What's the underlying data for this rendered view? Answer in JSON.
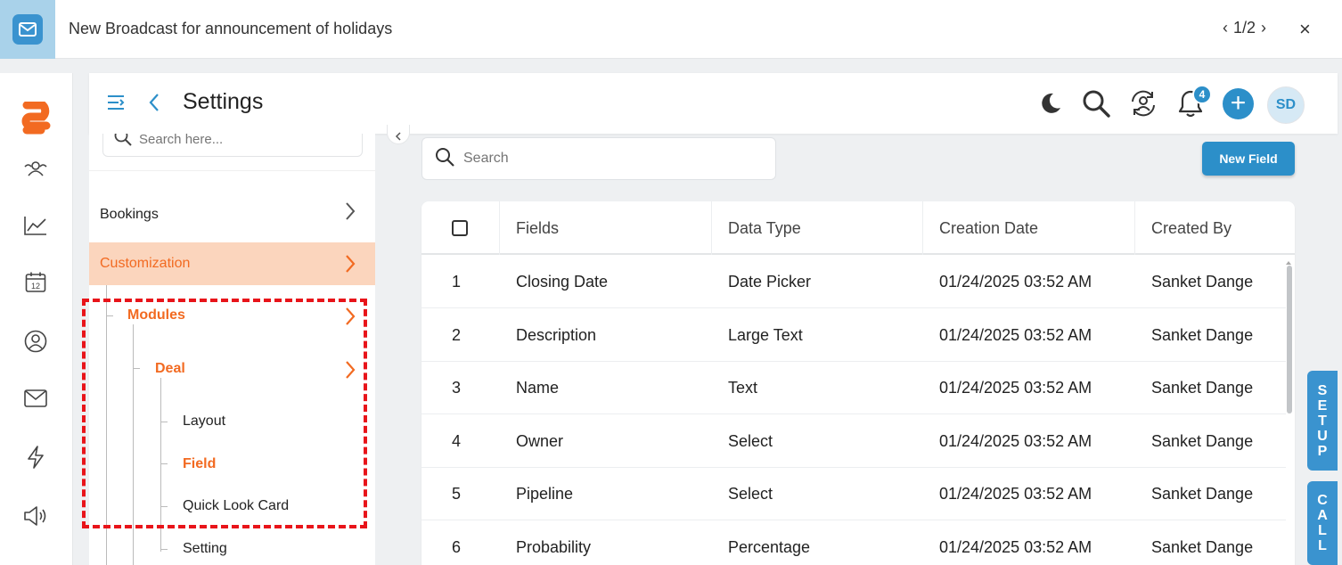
{
  "broadcast": {
    "title": "New Broadcast for announcement of holidays",
    "pager": "1/2",
    "prev": "‹",
    "next": "›",
    "close": "×"
  },
  "rail": {
    "icons": [
      "brand-logo-icon",
      "team-icon",
      "analytics-icon",
      "calendar-icon",
      "contacts-icon",
      "mail-icon",
      "automation-icon",
      "campaign-icon"
    ],
    "calendar_day": "12",
    "brand_color": "#f26a21"
  },
  "header": {
    "title": "Settings",
    "notification_count": "4",
    "plus": "+",
    "avatar_initials": "SD",
    "accent": "#2c8fc9"
  },
  "panel": {
    "search_placeholder": "Search here...",
    "items": {
      "bookings": "Bookings",
      "customization": "Customization",
      "modules": "Modules",
      "deal": "Deal",
      "layout": "Layout",
      "field": "Field",
      "quick_look_card": "Quick Look Card",
      "setting": "Setting"
    },
    "active_color": "#f26a21"
  },
  "main": {
    "search_placeholder": "Search",
    "new_field_label": "New Field",
    "columns": [
      "Fields",
      "Data Type",
      "Creation Date",
      "Created By"
    ],
    "rows": [
      {
        "n": "1",
        "field": "Closing Date",
        "type": "Date Picker",
        "date": "01/24/2025 03:52 AM",
        "by": "Sanket Dange"
      },
      {
        "n": "2",
        "field": "Description",
        "type": "Large Text",
        "date": "01/24/2025 03:52 AM",
        "by": "Sanket Dange"
      },
      {
        "n": "3",
        "field": "Name",
        "type": "Text",
        "date": "01/24/2025 03:52 AM",
        "by": "Sanket Dange"
      },
      {
        "n": "4",
        "field": "Owner",
        "type": "Select",
        "date": "01/24/2025 03:52 AM",
        "by": "Sanket Dange"
      },
      {
        "n": "5",
        "field": "Pipeline",
        "type": "Select",
        "date": "01/24/2025 03:52 AM",
        "by": "Sanket Dange"
      },
      {
        "n": "6",
        "field": "Probability",
        "type": "Percentage",
        "date": "01/24/2025 03:52 AM",
        "by": "Sanket Dange"
      }
    ]
  },
  "side_tabs": {
    "setup": [
      "S",
      "E",
      "T",
      "U",
      "P"
    ],
    "call": [
      "C",
      "A",
      "L",
      "L"
    ]
  }
}
